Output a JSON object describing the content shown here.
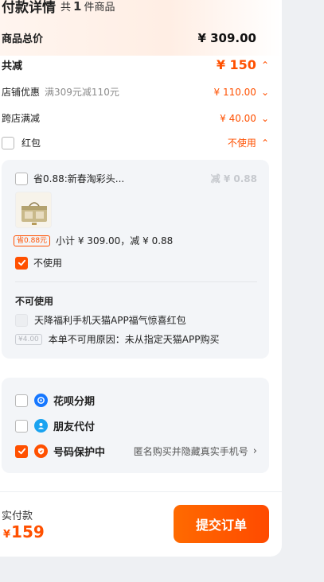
{
  "header": {
    "title": "付款详情",
    "count_prefix": "共",
    "count": "1",
    "count_suffix": "件商品"
  },
  "summary": {
    "goods_total_label": "商品总价",
    "goods_total_value": "¥ 309.00",
    "discount_total_label": "共减",
    "discount_total_value": "¥ 150",
    "shop_discount_label": "店铺优惠",
    "shop_discount_note": "满309元减110元",
    "shop_discount_value": "¥ 110.00",
    "cross_store_label": "跨店满减",
    "cross_store_value": "¥ 40.00",
    "redpacket_label": "红包",
    "redpacket_value": "不使用"
  },
  "redpacket_card": {
    "item_title": "省0.88:新春淘彩头...",
    "item_discount": "减 ¥ 0.88",
    "save_tag": "省0.88元",
    "subtotal_text": "小计 ¥ 309.00，减 ¥ 0.88",
    "not_use_label": "不使用",
    "unavailable_title": "不可使用",
    "unavailable_item": "天降福利手机天猫APP福气惊喜红包",
    "unavailable_tag": "¥4.00",
    "unavailable_reason": "本单不可用原因：未从指定天猫APP购买"
  },
  "payment_options": {
    "huabei_label": "花呗分期",
    "friend_pay_label": "朋友代付",
    "number_protect_label": "号码保护中",
    "number_protect_desc": "匿名购买并隐藏真实手机号"
  },
  "footer": {
    "actual_label": "实付款",
    "currency": "¥",
    "actual_value": "159",
    "submit_label": "提交订单"
  },
  "colors": {
    "accent": "#ff5000",
    "card_bg": "#f3f5f8",
    "page_bg": "#eef0f3"
  }
}
